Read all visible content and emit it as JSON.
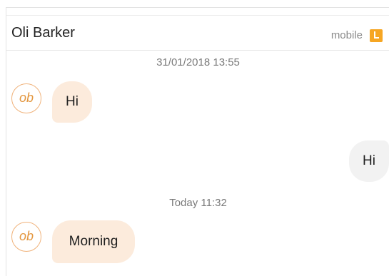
{
  "conversation": {
    "contact_name": "Oli Barker",
    "channel": "mobile",
    "channel_icon": "mobile-channel-icon",
    "accent_color": "#f6a623"
  },
  "messages": [
    {
      "type": "timestamp",
      "text": "31/01/2018 13:55"
    },
    {
      "type": "incoming",
      "avatar_initials": "ob",
      "text": "Hi"
    },
    {
      "type": "outgoing",
      "text": "Hi"
    },
    {
      "type": "timestamp",
      "text": "Today 11:32"
    },
    {
      "type": "incoming",
      "avatar_initials": "ob",
      "text": "Morning"
    }
  ]
}
